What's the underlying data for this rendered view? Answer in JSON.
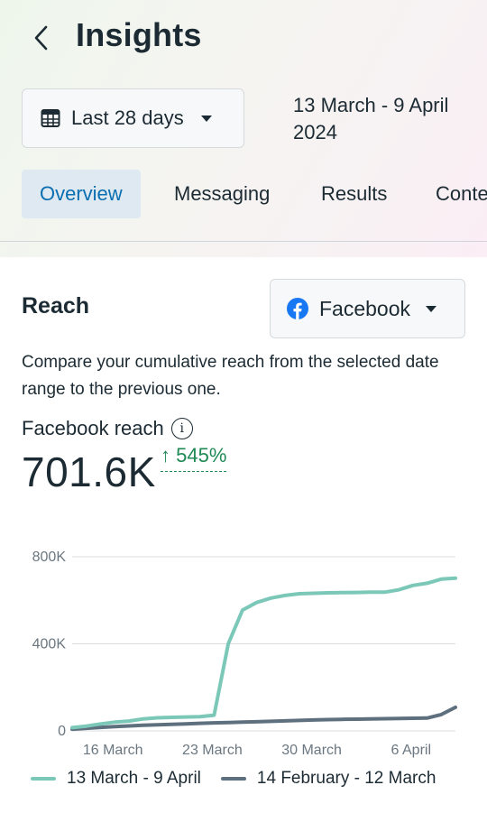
{
  "header": {
    "title": "Insights"
  },
  "date_selector": {
    "label": "Last 28 days"
  },
  "date_range": "13 March - 9 April 2024",
  "tabs": [
    {
      "label": "Overview",
      "active": true
    },
    {
      "label": "Messaging",
      "active": false
    },
    {
      "label": "Results",
      "active": false
    },
    {
      "label": "Content",
      "active": false
    }
  ],
  "reach": {
    "title": "Reach",
    "platform": "Facebook",
    "description": "Compare your cumulative reach from the selected date range to the previous one.",
    "metric_label": "Facebook reach",
    "metric_value": "701.6K",
    "delta": "↑ 545%"
  },
  "colors": {
    "current": "#7cc8b8",
    "previous": "#5e6f7e",
    "accent": "#0a6eb0",
    "positive": "#1f8a56",
    "facebook": "#1877f2"
  },
  "icons": {
    "back": "chevron-left-icon",
    "calendar": "calendar-icon",
    "caret": "caret-down-icon",
    "facebook": "facebook-icon",
    "info": "info-icon"
  },
  "chart_data": {
    "type": "line",
    "x_ticks": [
      "16 March",
      "23 March",
      "30 March",
      "6 April"
    ],
    "y_ticks": [
      "800K",
      "400K",
      "0"
    ],
    "ylim": [
      0,
      800000
    ],
    "grid": true,
    "legend_position": "bottom",
    "series": [
      {
        "name": "13 March - 9 April",
        "values": [
          15000,
          22000,
          32000,
          40000,
          45000,
          55000,
          60000,
          62000,
          64000,
          65000,
          72000,
          400000,
          555000,
          590000,
          610000,
          622000,
          630000,
          632000,
          634000,
          635000,
          636000,
          637000,
          637000,
          648000,
          668000,
          678000,
          697000,
          701600
        ]
      },
      {
        "name": "14 February - 12 March",
        "values": [
          8000,
          12000,
          16000,
          20000,
          23000,
          26000,
          28000,
          30000,
          32000,
          35000,
          37000,
          38000,
          40000,
          42000,
          44000,
          46000,
          48000,
          50000,
          52000,
          53000,
          54000,
          55000,
          56000,
          57000,
          58000,
          59000,
          75000,
          108000
        ]
      }
    ]
  }
}
